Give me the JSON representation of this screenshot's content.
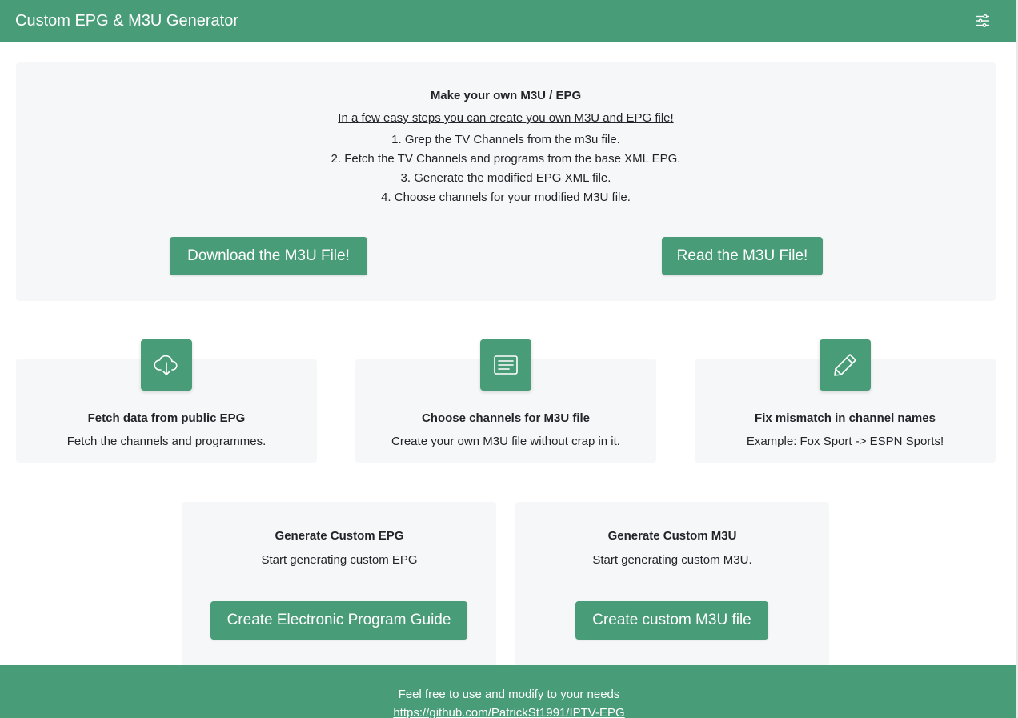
{
  "navbar": {
    "brand": "Custom EPG & M3U Generator",
    "toggler_icon": "sliders-icon"
  },
  "hero": {
    "heading": "Make your own M3U / EPG",
    "intro": "In a few easy steps you can create you own M3U and EPG file!",
    "steps": [
      "1. Grep the TV Channels from the m3u file.",
      "2. Fetch the TV Channels and programs from the base XML EPG.",
      "3. Generate the modified EPG XML file.",
      "4. Choose channels for your modified M3U file."
    ],
    "download_button": "Download the M3U File!",
    "read_button": "Read the M3U File!"
  },
  "features": [
    {
      "icon": "cloud-download-icon",
      "title": "Fetch data from public EPG",
      "desc": "Fetch the channels and programmes."
    },
    {
      "icon": "document-text-icon",
      "title": "Choose channels for M3U file",
      "desc": "Create your own M3U file without crap in it."
    },
    {
      "icon": "pencil-icon",
      "title": "Fix mismatch in channel names",
      "desc": "Example: Fox Sport -> ESPN Sports!"
    }
  ],
  "generators": [
    {
      "title": "Generate Custom EPG",
      "desc": "Start generating custom EPG",
      "button": "Create Electronic Program Guide"
    },
    {
      "title": "Generate Custom M3U",
      "desc": "Start generating custom M3U.",
      "button": "Create custom M3U file"
    }
  ],
  "footer": {
    "note": "Feel free to use and modify to your needs",
    "link": "https://github.com/PatrickSt1991/IPTV-EPG"
  },
  "colors": {
    "brand_green": "#489c78",
    "panel_bg": "#f6f7f9",
    "text": "#212529"
  }
}
